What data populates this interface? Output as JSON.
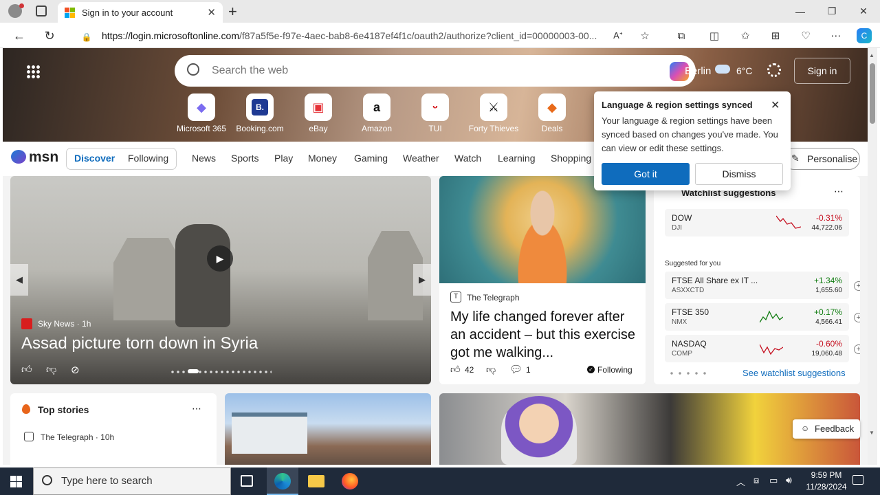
{
  "browser": {
    "tab_title": "Sign in to your account",
    "url_host": "https://login.microsoftonline.com",
    "url_path": "/f87a5f5e-f97e-4aec-bab8-6e4187ef4f1c/oauth2/authorize?client_id=00000003-00..."
  },
  "msn": {
    "search_placeholder": "Search the web",
    "location": "Berlin",
    "weather": "6°C",
    "sign_in": "Sign in",
    "quick_links": [
      "Microsoft 365",
      "Booking.com",
      "eBay",
      "Amazon",
      "TUI",
      "Forty Thieves",
      "Deals"
    ],
    "brand": "msn",
    "feed_tabs": [
      "Discover",
      "Following"
    ],
    "nav": [
      "News",
      "Sports",
      "Play",
      "Money",
      "Gaming",
      "Weather",
      "Watch",
      "Learning",
      "Shopping"
    ],
    "personalise": "Personalise",
    "hero_story": {
      "source": "Sky News",
      "age": "1h",
      "headline": "Assad picture torn down in Syria"
    },
    "telegraph_story": {
      "source": "The Telegraph",
      "headline": "My life changed forever after an accident – but this exercise got me walking...",
      "likes": "42",
      "comments": "1",
      "following": "Following"
    },
    "watchlist": {
      "title": "Watchlist suggestions",
      "top": {
        "name": "DOW",
        "symbol": "DJI",
        "change": "-0.31%",
        "price": "44,722.06"
      },
      "suggested_label": "Suggested for you",
      "rows": [
        {
          "name": "FTSE All Share ex IT ...",
          "symbol": "ASXXCTD",
          "change": "+1.34%",
          "price": "1,655.60"
        },
        {
          "name": "FTSE 350",
          "symbol": "NMX",
          "change": "+0.17%",
          "price": "4,566.41"
        },
        {
          "name": "NASDAQ",
          "symbol": "COMP",
          "change": "-0.60%",
          "price": "19,060.48"
        }
      ],
      "see_more": "See watchlist suggestions"
    },
    "top_stories": {
      "title": "Top stories",
      "first_source": "The Telegraph · 10h"
    },
    "feedback": "Feedback"
  },
  "popup": {
    "title": "Language & region settings synced",
    "body": "Your language & region settings have been synced based on changes you've made. You can view or edit these settings.",
    "primary": "Got it",
    "secondary": "Dismiss"
  },
  "taskbar": {
    "search_placeholder": "Type here to search",
    "time": "9:59 PM",
    "date": "11/28/2024"
  },
  "colors": {
    "accent": "#0f6cbd",
    "positive": "#107c10",
    "negative": "#c50f1f",
    "taskbar": "#1f2a3a"
  }
}
